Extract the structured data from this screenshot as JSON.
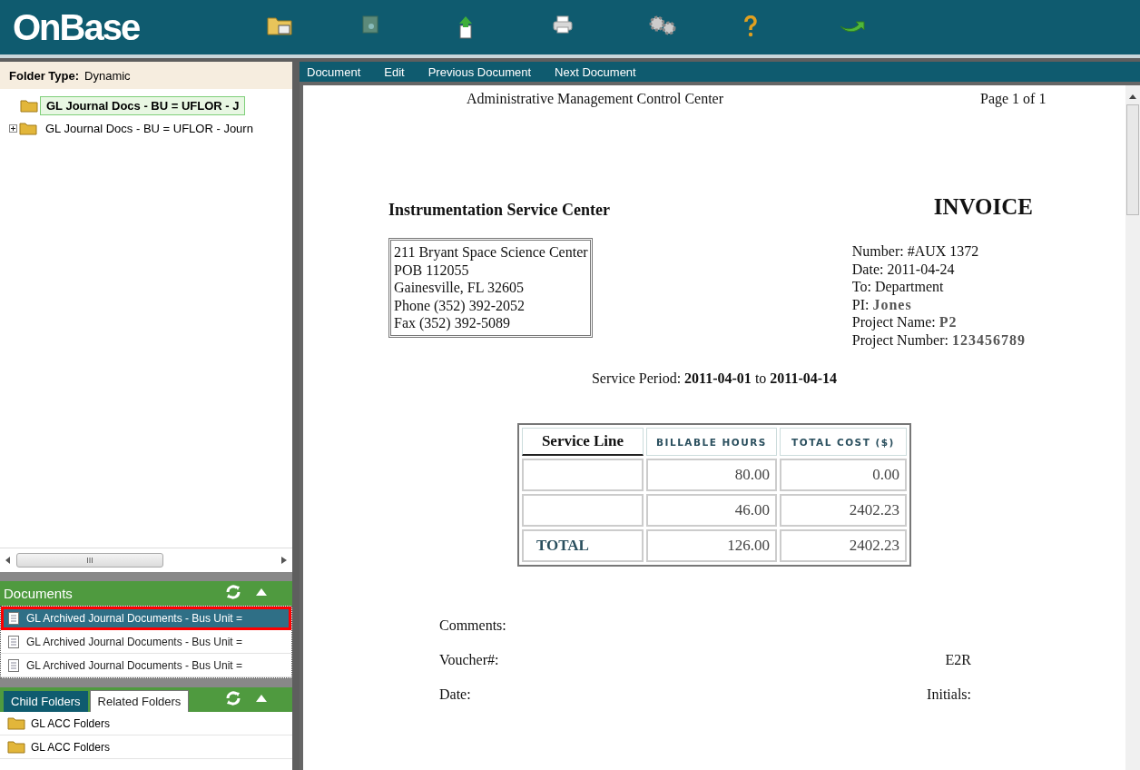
{
  "app": {
    "logo": "OnBase"
  },
  "folder_panel": {
    "label": "Folder Type:",
    "value": "Dynamic",
    "tree": [
      {
        "label": "GL Journal Docs - BU = UFLOR - J",
        "selected": true
      },
      {
        "label": "GL Journal Docs - BU = UFLOR - Journ",
        "selected": false,
        "expanded": false
      }
    ],
    "scrollbar_grip": "III"
  },
  "documents": {
    "title": "Documents",
    "items": [
      {
        "label": "GL Archived Journal Documents - Bus Unit =",
        "selected": true
      },
      {
        "label": "GL Archived Journal Documents - Bus Unit =",
        "selected": false
      },
      {
        "label": "GL Archived Journal Documents - Bus Unit =",
        "selected": false
      }
    ]
  },
  "folders": {
    "tabs": [
      {
        "label": "Child Folders",
        "selected": false
      },
      {
        "label": "Related Folders",
        "selected": true
      }
    ],
    "items": [
      {
        "label": "GL ACC Folders"
      },
      {
        "label": "GL ACC Folders"
      }
    ]
  },
  "menu": [
    "Document",
    "Edit",
    "Previous Document",
    "Next Document"
  ],
  "document": {
    "header": "Administrative Management Control Center",
    "page": "Page 1 of 1",
    "company": "Instrumentation Service Center",
    "title": "INVOICE",
    "address": [
      "211 Bryant Space Science Center",
      "POB 112055",
      "Gainesville, FL 32605",
      "Phone (352) 392-2052",
      "Fax (352) 392-5089"
    ],
    "details": [
      "Number: #AUX 1372",
      "Date: 2011-04-24",
      "To: Department",
      "PI: **Jones**",
      "Project Name:  **P2**",
      "Project Number: **123456789**"
    ],
    "service_period": "Service Period: **2011-04-01** to **2011-04-14**",
    "table": {
      "columns": [
        "Service Line",
        "BILLABLE HOURS",
        "TOTAL COST ($)"
      ],
      "rows": [
        {
          "hours": "80.00",
          "cost": "0.00"
        },
        {
          "hours": "46.00",
          "cost": "2402.23"
        },
        {
          "label": "TOTAL",
          "hours": "126.00",
          "cost": "2402.23"
        }
      ]
    },
    "fields": [
      {
        "label": "Comments:"
      },
      {
        "label": "Voucher#:",
        "value": "E2R"
      },
      {
        "label": "Date:",
        "value": "Initials:"
      }
    ]
  }
}
